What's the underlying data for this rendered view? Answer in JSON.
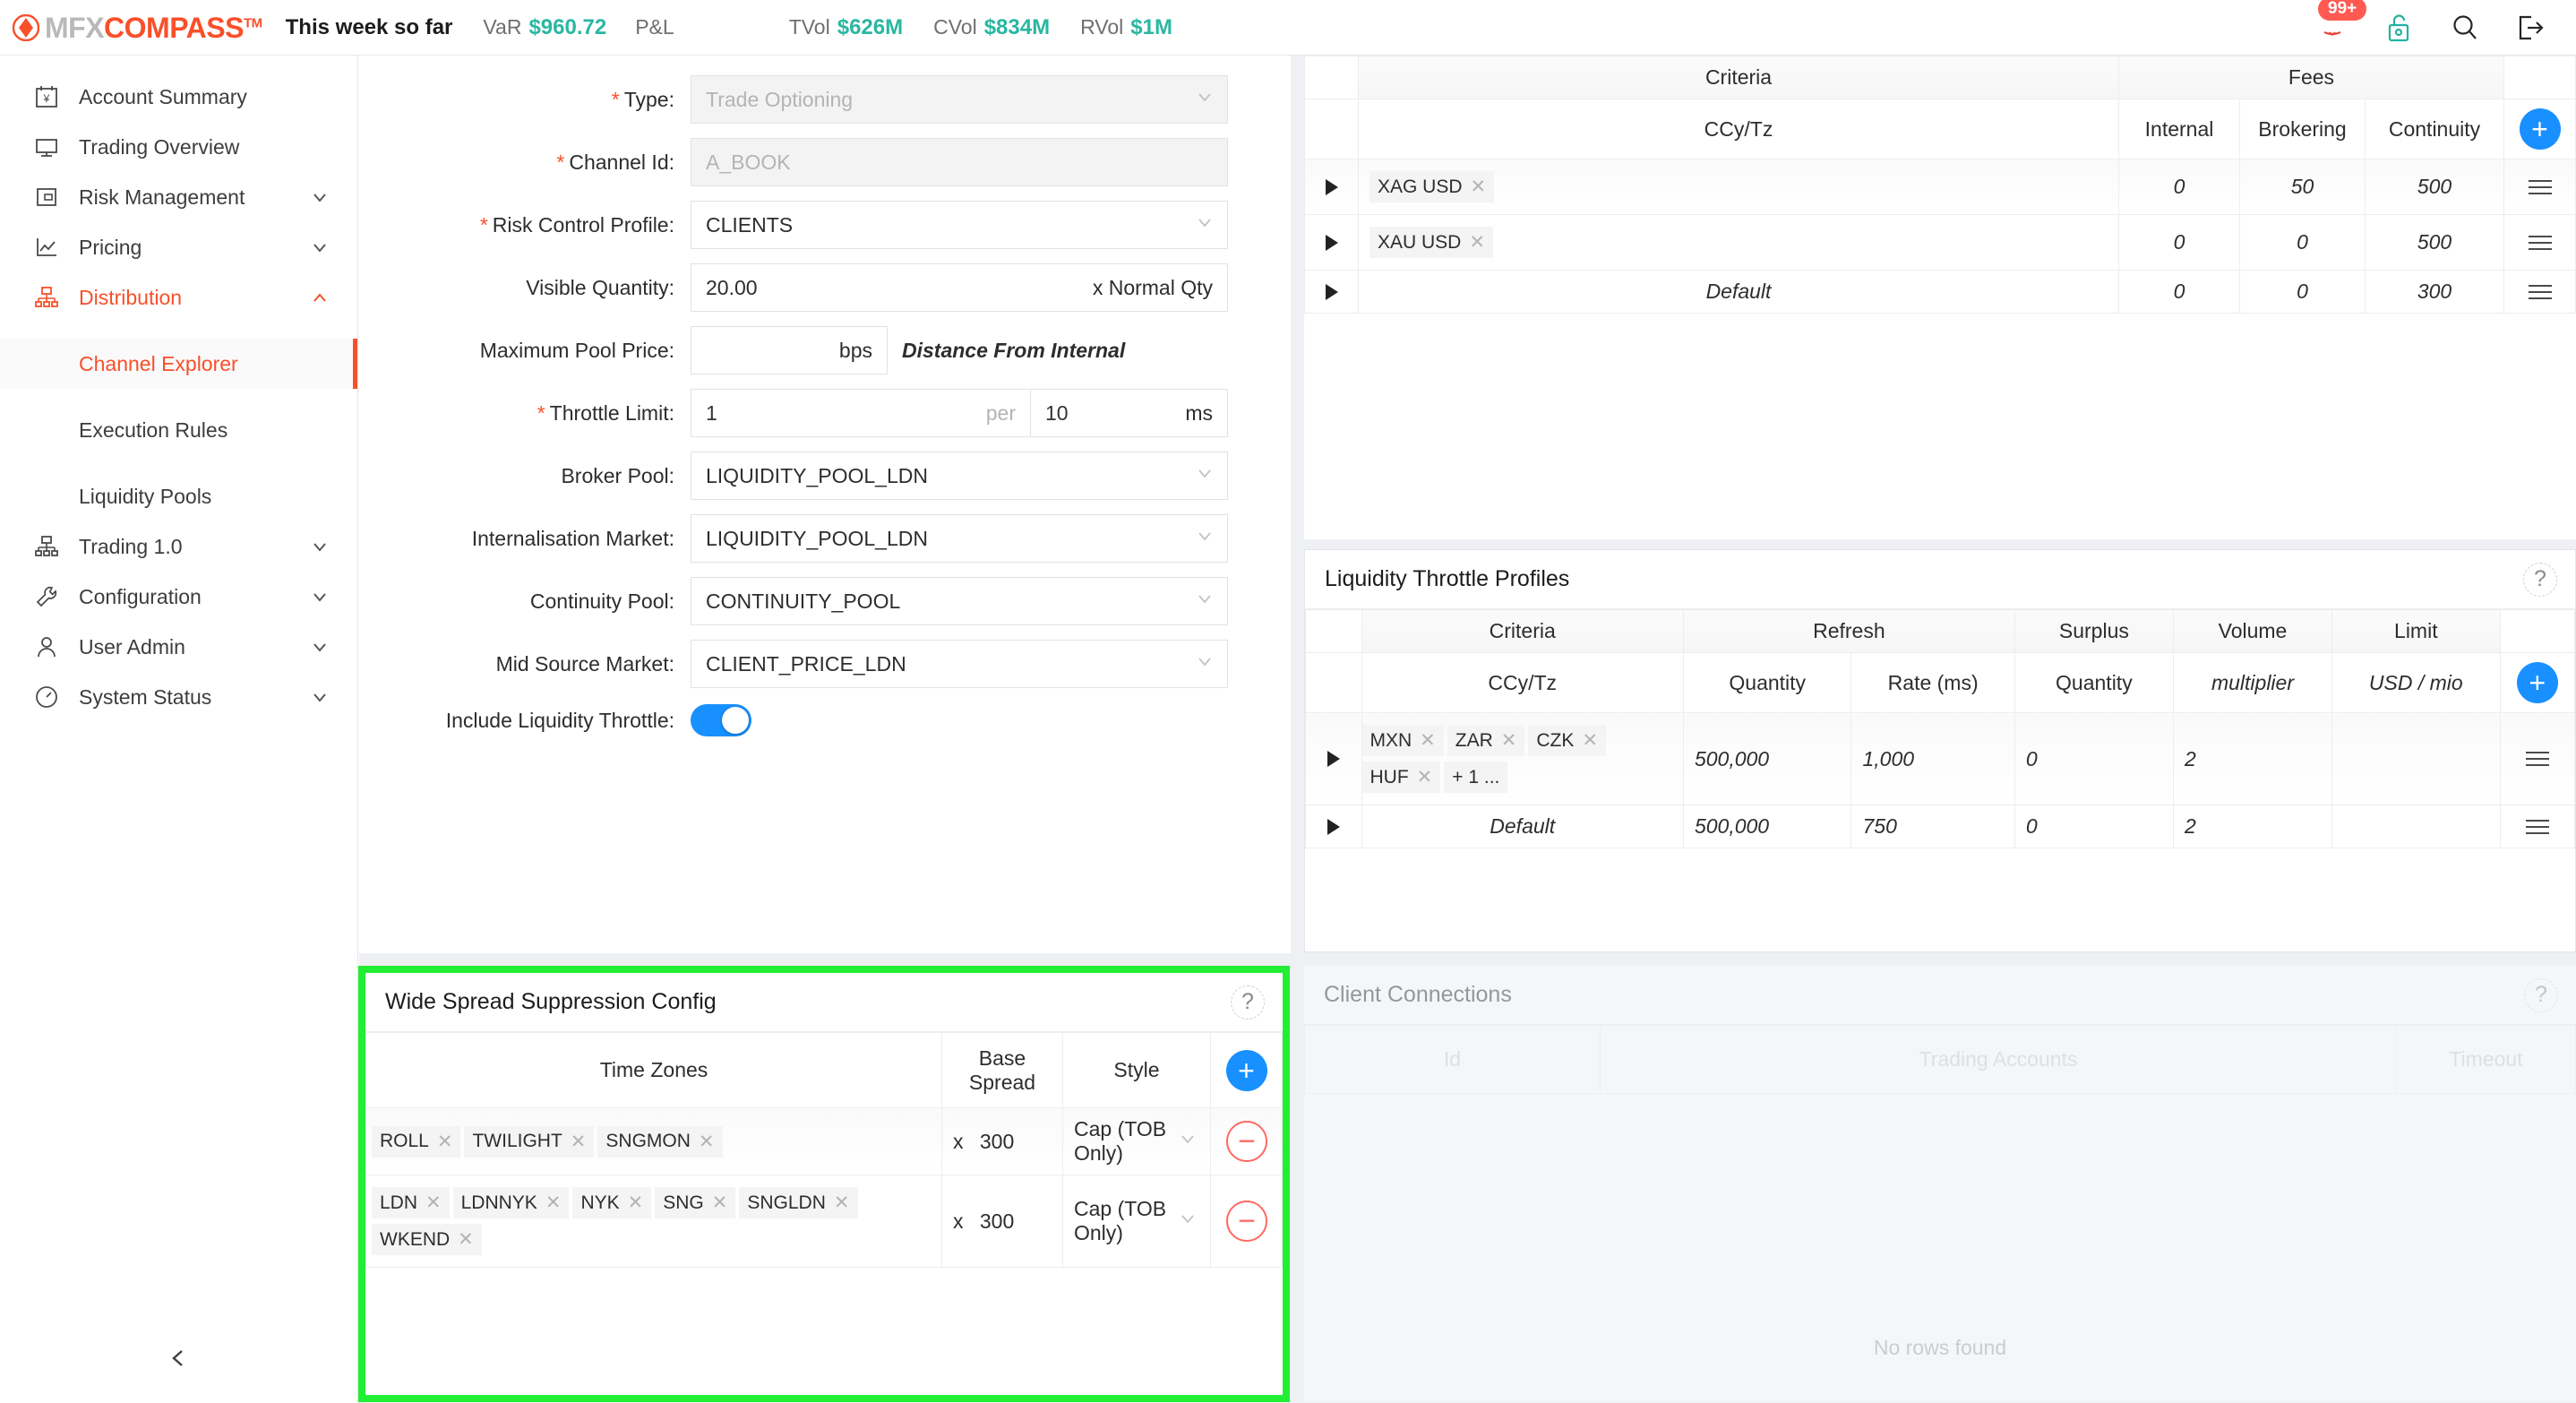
{
  "header": {
    "logo": {
      "mark": "diamond-logo",
      "mfx": "MFX",
      "compass": "COMPASS",
      "tm": "TM"
    },
    "period_label": "This week so far",
    "stats": [
      {
        "label": "VaR",
        "value": "$960.72"
      },
      {
        "label": "P&L",
        "value": ""
      },
      {
        "label": "TVol",
        "value": "$626M"
      },
      {
        "label": "CVol",
        "value": "$834M"
      },
      {
        "label": "RVol",
        "value": "$1M"
      }
    ],
    "notifications_badge": "99+",
    "icons": [
      "notification-bell-icon",
      "unlock-icon",
      "search-icon",
      "logout-icon"
    ],
    "accent_color": "#f8502a",
    "teal_color": "#2ab7a2",
    "badge_color": "#ff5a52"
  },
  "sidebar": {
    "items": [
      {
        "label": "Account Summary",
        "icon": "calendar-yen-icon",
        "expandable": false,
        "active": false
      },
      {
        "label": "Trading Overview",
        "icon": "monitor-icon",
        "expandable": false,
        "active": false
      },
      {
        "label": "Risk Management",
        "icon": "safe-box-icon",
        "expandable": true,
        "chevron": "chevron-down",
        "active": false
      },
      {
        "label": "Pricing",
        "icon": "line-chart-icon",
        "expandable": true,
        "chevron": "chevron-down",
        "active": false
      },
      {
        "label": "Distribution",
        "icon": "sitemap-icon",
        "expandable": true,
        "chevron": "chevron-up",
        "active": true
      }
    ],
    "sub_items": [
      {
        "label": "Channel Explorer",
        "active": true
      },
      {
        "label": "Execution Rules",
        "active": false
      },
      {
        "label": "Liquidity Pools",
        "active": false
      }
    ],
    "items_after": [
      {
        "label": "Trading 1.0",
        "icon": "sitemap-icon",
        "expandable": true,
        "chevron": "chevron-down"
      },
      {
        "label": "Configuration",
        "icon": "wrench-icon",
        "expandable": true,
        "chevron": "chevron-down"
      },
      {
        "label": "User Admin",
        "icon": "user-icon",
        "expandable": true,
        "chevron": "chevron-down"
      },
      {
        "label": "System Status",
        "icon": "gauge-icon",
        "expandable": true,
        "chevron": "chevron-down"
      }
    ],
    "collapse_icon": "chevron-left-icon"
  },
  "form": {
    "fields": [
      {
        "label": "Type:",
        "required": true,
        "value": "Trade Optioning",
        "control": "select",
        "disabled": true
      },
      {
        "label": "Channel Id:",
        "required": true,
        "value": "A_BOOK",
        "control": "text",
        "disabled": true
      },
      {
        "label": "Risk Control Profile:",
        "required": true,
        "value": "CLIENTS",
        "control": "select",
        "disabled": false
      },
      {
        "label": "Visible Quantity:",
        "required": false,
        "value": "20.00",
        "control": "text",
        "suffix": "x Normal Qty"
      },
      {
        "label": "Maximum Pool Price:",
        "required": false,
        "value": "",
        "control": "text",
        "suffix": "bps",
        "hint": "Distance From Internal"
      },
      {
        "label": "Throttle Limit:",
        "required": true,
        "value": "1",
        "mid": "per",
        "value2": "10",
        "unit": "ms",
        "control": "split"
      },
      {
        "label": "Broker Pool:",
        "required": false,
        "value": "LIQUIDITY_POOL_LDN",
        "control": "select"
      },
      {
        "label": "Internalisation Market:",
        "required": false,
        "value": "LIQUIDITY_POOL_LDN",
        "control": "select"
      },
      {
        "label": "Continuity Pool:",
        "required": false,
        "value": "CONTINUITY_POOL",
        "control": "select"
      },
      {
        "label": "Mid Source Market:",
        "required": false,
        "value": "CLIENT_PRICE_LDN",
        "control": "select"
      },
      {
        "label": "Include Liquidity Throttle:",
        "required": false,
        "control": "toggle",
        "toggle_on": true
      }
    ]
  },
  "fees_table": {
    "group_headers": [
      "",
      "Criteria",
      "Fees",
      ""
    ],
    "sub_headers": [
      "",
      "CCy/Tz",
      "Internal",
      "Brokering",
      "Continuity",
      ""
    ],
    "add_label": "+",
    "rows": [
      {
        "expander": "expand-triangle",
        "tags": [
          "XAG USD"
        ],
        "default": false,
        "internal": "0",
        "brokering": "50",
        "continuity": "500",
        "menu": "row-menu-icon"
      },
      {
        "expander": "expand-triangle",
        "tags": [
          "XAU USD"
        ],
        "default": false,
        "internal": "0",
        "brokering": "0",
        "continuity": "500",
        "menu": "row-menu-icon"
      },
      {
        "expander": "expand-triangle",
        "tags": [],
        "default": true,
        "default_label": "Default",
        "internal": "0",
        "brokering": "0",
        "continuity": "300",
        "menu": "row-menu-icon"
      }
    ]
  },
  "throttle_panel": {
    "title": "Liquidity Throttle Profiles",
    "help": "?",
    "group_headers": [
      "",
      "Criteria",
      "Refresh",
      "Surplus",
      "Volume",
      "Limit",
      ""
    ],
    "sub_headers": [
      "",
      "CCy/Tz",
      "Quantity",
      "Rate (ms)",
      "Quantity",
      "multiplier",
      "USD / mio",
      ""
    ],
    "add_label": "+",
    "rows": [
      {
        "expander": "expand-triangle",
        "tags": [
          "MXN",
          "ZAR",
          "CZK",
          "HUF",
          "+ 1 ..."
        ],
        "default": false,
        "refresh_qty": "500,000",
        "rate_ms": "1,000",
        "surplus_qty": "0",
        "volume_mult": "2",
        "limit": "",
        "menu": "row-menu-icon"
      },
      {
        "expander": "expand-triangle",
        "tags": [],
        "default": true,
        "default_label": "Default",
        "refresh_qty": "500,000",
        "rate_ms": "750",
        "surplus_qty": "0",
        "volume_mult": "2",
        "limit": "",
        "menu": "row-menu-icon"
      }
    ]
  },
  "wide_spread_panel": {
    "title": "Wide Spread Suppression Config",
    "help": "?",
    "highlight_color": "#22ee33",
    "headers": [
      "Time Zones",
      "Base Spread",
      "Style",
      ""
    ],
    "add_label": "+",
    "rows": [
      {
        "tags": [
          "ROLL",
          "TWILIGHT",
          "SNGMON"
        ],
        "multiplier_prefix": "x",
        "base_spread": "300",
        "style": "Cap (TOB Only)",
        "remove_label": "−"
      },
      {
        "tags": [
          "LDN",
          "LDNNYK",
          "NYK",
          "SNG",
          "SNGLDN",
          "WKEND"
        ],
        "multiplier_prefix": "x",
        "base_spread": "300",
        "style": "Cap (TOB Only)",
        "remove_label": "−"
      }
    ]
  },
  "client_connections": {
    "title": "Client Connections",
    "help": "?",
    "headers": [
      "Id",
      "Trading Accounts",
      "Timeout"
    ],
    "empty_message": "No rows found"
  }
}
